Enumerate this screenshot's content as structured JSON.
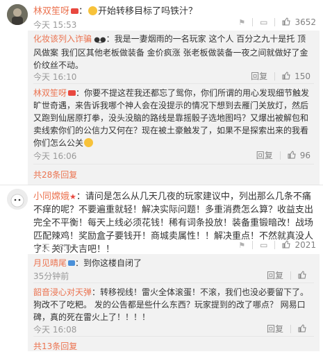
{
  "comments": [
    {
      "user": "林双笙呀",
      "text": "开始转移目标了吗铁汁？",
      "time": "今天 15:53",
      "likes": "3652",
      "replies": [
        {
          "user": "化妆该列入诈骗",
          "text": "我是一妻烟雨的一名玩家 这个人 百分之九十是托 顶风做案 我们区其他老板做装备 金价疯涨 张老板做装备一夜之间就做好了金价纹丝不动。",
          "time": "今天 16:10",
          "reply_label": "回复",
          "likes": "150"
        },
        {
          "user": "林双笙呀",
          "text": "你要不提这茬我还都忘了鸳你，你们所谓的用心发现细节触发旷世奇遇，来告诉我哪个神人会在没提示的情况下想到去雁门关放灯，然后又跑到仙居原打拳，没头没脑的路线是靠摇骰子选地图吗？又爆出被解包和卖线索你们的公信力又何在？现在被土豪触发了，如果不是探索出来的我看你们怎么公关",
          "time": "今天 16:06",
          "reply_label": "回复",
          "likes": "96"
        }
      ],
      "more_label": "共28条回复"
    },
    {
      "user": "小同嫦娥",
      "text": "请问是怎么从几天几夜的玩家建议中，列出那么几条不痛不痒的呢？不要遍重就轻！解决实际问题！多重消费怎么算？收益支出完全不平衡！每天上线必须花钱！稀有词条投放！装备重锻暗改！战场匹配辣鸡！奖励盒子要钱开！商城卖属性！！解决重点！不然就真没人了！关门大吉吧！！",
      "time": "今天 16:07",
      "likes": "2021",
      "replies": [
        {
          "user": "月见晴尾",
          "text": "到你这楼自闭了",
          "time": "35分钟前",
          "reply_label": "回复"
        },
        {
          "user": "韶音浸心对天弹",
          "text": "转移视线！雷火全体滚蛋！不滚，我们也没必要留下了。 狗改不了吃粑。 发的公告都是些什么东西？玩家提到的改了哪点？ 网易口碑，真的死在雷火上了！！！！",
          "time": "今天 16:08",
          "reply_label": "回复"
        }
      ],
      "more_label": "共13条回复"
    }
  ]
}
